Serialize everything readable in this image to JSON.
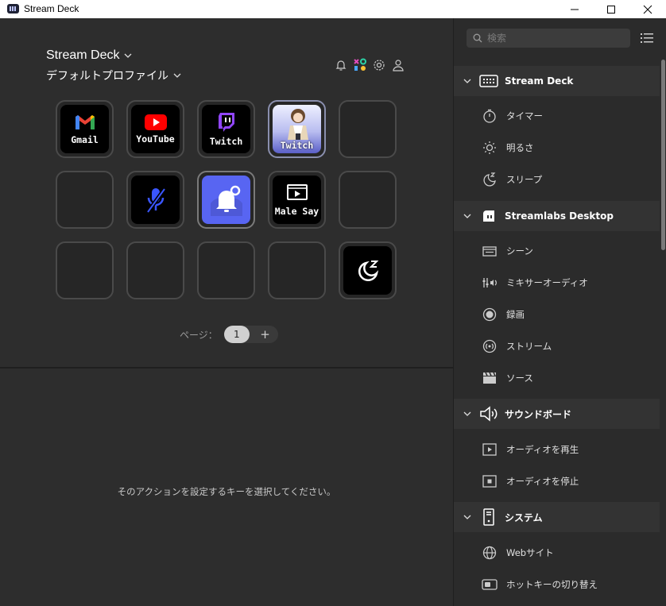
{
  "window": {
    "title": "Stream Deck"
  },
  "header": {
    "device_name": "Stream Deck",
    "profile_name": "デフォルトプロファイル"
  },
  "keys": [
    {
      "label": "Gmail",
      "icon": "gmail-icon"
    },
    {
      "label": "YouTube",
      "icon": "youtube-icon"
    },
    {
      "label": "Twitch",
      "icon": "twitch-icon"
    },
    {
      "label": "Twitch",
      "icon": "character-avatar-icon"
    },
    {
      "label": "",
      "icon": ""
    },
    {
      "label": "",
      "icon": ""
    },
    {
      "label": "",
      "icon": "mic-muted-icon"
    },
    {
      "label": "",
      "icon": "discord-bell-icon"
    },
    {
      "label": "Male Say",
      "icon": "play-screen-icon"
    },
    {
      "label": "",
      "icon": ""
    },
    {
      "label": "",
      "icon": ""
    },
    {
      "label": "",
      "icon": ""
    },
    {
      "label": "",
      "icon": ""
    },
    {
      "label": "",
      "icon": ""
    },
    {
      "label": "",
      "icon": "sleep-moon-icon"
    }
  ],
  "pager": {
    "label": "ページ：",
    "current": "1",
    "add": "+"
  },
  "hint": "そのアクションを設定するキーを選択してください。",
  "sidebar": {
    "search_placeholder": "検索",
    "categories": [
      {
        "name": "Stream Deck",
        "items": [
          "タイマー",
          "明るさ",
          "スリープ"
        ]
      },
      {
        "name": "Streamlabs Desktop",
        "items": [
          "シーン",
          "ミキサーオーディオ",
          "録画",
          "ストリーム",
          "ソース"
        ]
      },
      {
        "name": "サウンドボード",
        "items": [
          "オーディオを再生",
          "オーディオを停止"
        ]
      },
      {
        "name": "システム",
        "items": [
          "Webサイト",
          "ホットキーの切り替え"
        ]
      }
    ]
  },
  "colors": {
    "accent_purple": "#5865f2",
    "gmail_red": "#ea4335",
    "youtube_red": "#ff0000",
    "twitch_purple": "#9146ff"
  }
}
